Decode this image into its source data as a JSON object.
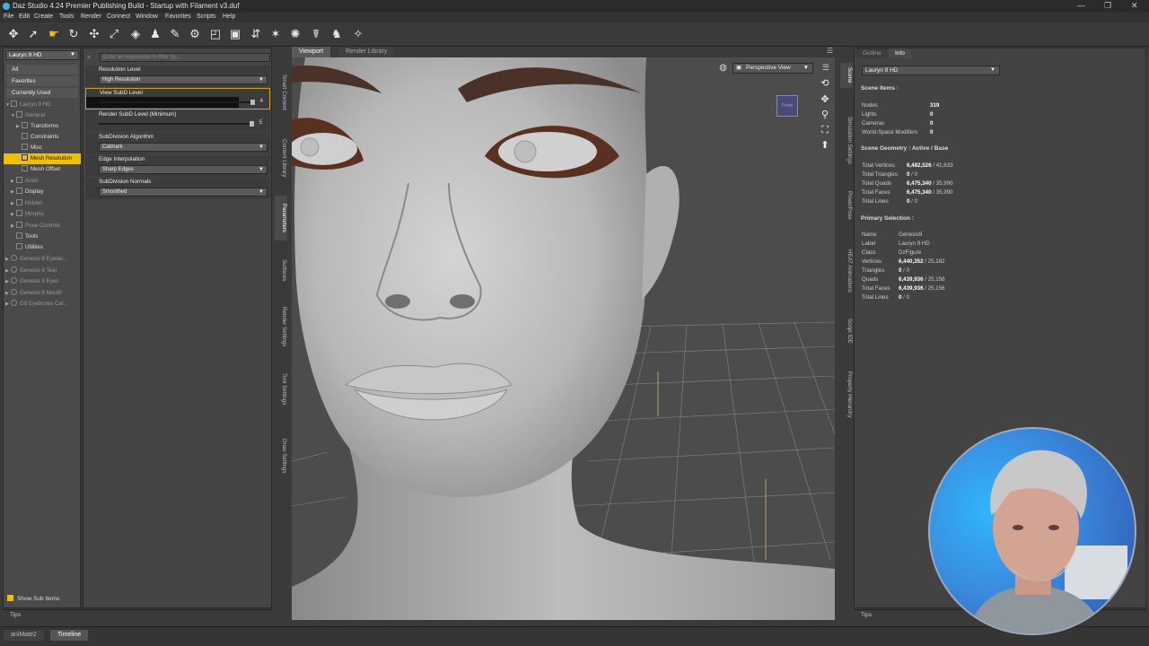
{
  "window": {
    "title": "Daz Studio 4.24 Premier Publishing Build - Startup with Filament v3.duf",
    "controls": [
      "—",
      "❐",
      "✕"
    ]
  },
  "menu": [
    "File",
    "Edit",
    "Create",
    "Tools",
    "Render",
    "Connect",
    "Window",
    "Favorites",
    "Scripts",
    "Help"
  ],
  "scene": {
    "selector": "Lauryn 9 HD",
    "filters": [
      "All",
      "Favorites",
      "Currently Used"
    ],
    "tree": [
      {
        "label": "Lauryn 9 HD",
        "level": 0,
        "dim": true
      },
      {
        "label": "General",
        "level": 1,
        "dim": true
      },
      {
        "label": "Transforms",
        "level": 2
      },
      {
        "label": "Constraints",
        "level": 2
      },
      {
        "label": "Misc",
        "level": 2
      },
      {
        "label": "Mesh Resolution",
        "level": 2,
        "selected": true
      },
      {
        "label": "Mesh Offset",
        "level": 2
      },
      {
        "label": "Actor",
        "level": 1,
        "dim": true
      },
      {
        "label": "Display",
        "level": 1
      },
      {
        "label": "Hidden",
        "level": 1,
        "dim": true
      },
      {
        "label": "Morphs",
        "level": 1,
        "dim": true
      },
      {
        "label": "Pose Controls",
        "level": 1,
        "dim": true
      },
      {
        "label": "Tools",
        "level": 1
      },
      {
        "label": "Utilities",
        "level": 1
      },
      {
        "label": "Genesis 9 Eyelas...",
        "level": 0,
        "dim": true
      },
      {
        "label": "Genesis 9 Tear",
        "level": 0,
        "dim": true
      },
      {
        "label": "Genesis 9 Eyes",
        "level": 0,
        "dim": true
      },
      {
        "label": "Genesis 9 Mouth",
        "level": 0,
        "dim": true
      },
      {
        "label": "G9 Eyebrows Car...",
        "level": 0,
        "dim": true
      }
    ],
    "show_sub_items": "Show Sub Items",
    "tips": "Tips"
  },
  "params": {
    "search_placeholder": "Enter an expression to filter by...",
    "rows": [
      {
        "label": "Resolution Level",
        "value": "High Resolution",
        "kind": "dropdown"
      },
      {
        "label": "View SubD Level",
        "value": "4",
        "kind": "slider",
        "highlight": true
      },
      {
        "label": "Render SubD Level (Minimum)",
        "value": "5",
        "kind": "slider"
      },
      {
        "label": "SubDivision Algorithm",
        "value": "Catmark",
        "kind": "dropdown"
      },
      {
        "label": "Edge Interpolation",
        "value": "Sharp Edges",
        "kind": "dropdown"
      },
      {
        "label": "SubDivision Normals",
        "value": "Smoothed",
        "kind": "dropdown"
      }
    ],
    "tips": "Tips"
  },
  "left_vtabs": [
    "Smart Content",
    "Content Library",
    "Parameters",
    "Surfaces",
    "Render Settings",
    "Tool Settings",
    "Draw Settings"
  ],
  "viewport": {
    "tabs": [
      "Viewport",
      "Render Library"
    ],
    "camera": "Perspective View",
    "cube_label": "Front"
  },
  "right_vtabs": [
    "Scene",
    "Simulation Settings",
    "PowerPose",
    "HEAT Animations",
    "Script IDE",
    "Property Hierarchy"
  ],
  "info": {
    "tabs": [
      "Outline",
      "Info"
    ],
    "selector": "Lauryn 9 HD",
    "scene_items_title": "Scene Items :",
    "scene_items": [
      {
        "k": "Nodes",
        "v": "319"
      },
      {
        "k": "Lights",
        "v": "0"
      },
      {
        "k": "Cameras",
        "v": "0"
      },
      {
        "k": "World-Space Modifiers",
        "v": "0"
      }
    ],
    "geometry_title": "Scene Geometry : Active / Base",
    "geometry": [
      {
        "k": "Total Vertices",
        "a": "6,482,526",
        "b": " / 41,633"
      },
      {
        "k": "Total Triangles",
        "a": "0",
        "b": " / 0"
      },
      {
        "k": "Total Quads",
        "a": "6,475,340",
        "b": " / 35,990"
      },
      {
        "k": "Total Faces",
        "a": "6,475,340",
        "b": " / 35,990"
      },
      {
        "k": "Total Lines",
        "a": "0",
        "b": " / 0"
      }
    ],
    "selection_title": "Primary Selection :",
    "selection": [
      {
        "k": "Name",
        "a": "Genesis9",
        "b": ""
      },
      {
        "k": "Label",
        "a": "Lauryn 9 HD",
        "b": ""
      },
      {
        "k": "Class",
        "a": "DzFigure",
        "b": ""
      },
      {
        "k": "Vertices",
        "a": "6,440,352",
        "b": " / 25,182"
      },
      {
        "k": "Triangles",
        "a": "0",
        "b": " / 0"
      },
      {
        "k": "Quads",
        "a": "6,439,936",
        "b": " / 25,156"
      },
      {
        "k": "Total Faces",
        "a": "6,439,936",
        "b": " / 25,156"
      },
      {
        "k": "Total Lines",
        "a": "0",
        "b": " / 0"
      }
    ],
    "tips": "Tips"
  },
  "bottom_tabs": [
    "aniMate2",
    "Timeline"
  ]
}
